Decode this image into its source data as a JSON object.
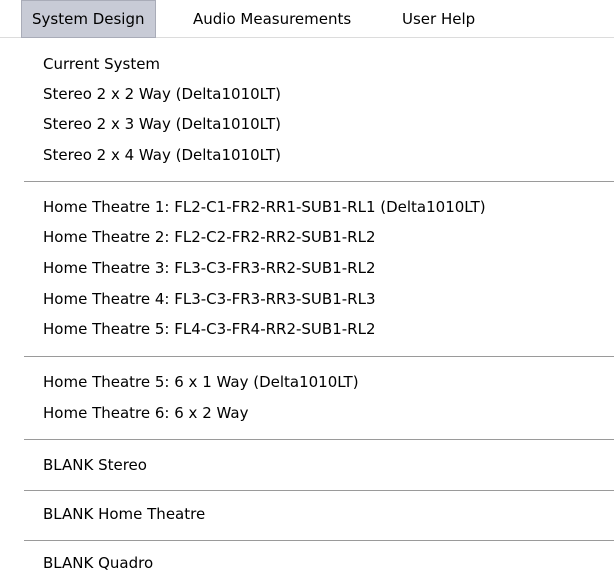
{
  "menubar": {
    "items": [
      {
        "label": "System Design"
      },
      {
        "label": "Audio Measurements"
      },
      {
        "label": "User Help"
      }
    ]
  },
  "dropdown": {
    "groups": [
      {
        "items": [
          "Current System",
          "Stereo 2 x 2 Way (Delta1010LT)",
          "Stereo 2 x 3 Way (Delta1010LT)",
          "Stereo 2 x 4 Way (Delta1010LT)"
        ]
      },
      {
        "items": [
          "Home Theatre 1: FL2-C1-FR2-RR1-SUB1-RL1 (Delta1010LT)",
          "Home Theatre 2: FL2-C2-FR2-RR2-SUB1-RL2",
          "Home Theatre 3: FL3-C3-FR3-RR2-SUB1-RL2",
          "Home Theatre 4: FL3-C3-FR3-RR3-SUB1-RL3",
          "Home Theatre 5: FL4-C3-FR4-RR2-SUB1-RL2"
        ]
      },
      {
        "items": [
          "Home Theatre 5: 6 x 1 Way (Delta1010LT)",
          "Home Theatre 6: 6 x 2 Way"
        ]
      },
      {
        "items": [
          "BLANK Stereo"
        ]
      },
      {
        "items": [
          "BLANK Home Theatre"
        ]
      },
      {
        "items": [
          "BLANK Quadro"
        ]
      }
    ]
  }
}
